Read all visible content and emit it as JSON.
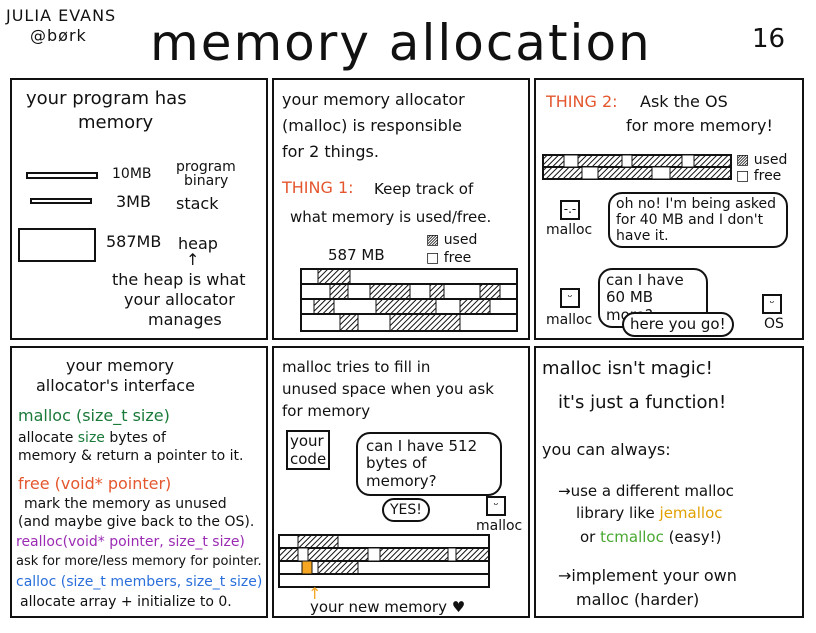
{
  "header": {
    "author_name": "JULIA EVANS",
    "author_handle": "@børk",
    "title": "memory allocation",
    "page_number": "16"
  },
  "panel1": {
    "line1": "your program has",
    "line2": "memory",
    "items": [
      {
        "size": "10MB",
        "label1": "program",
        "label2": "binary"
      },
      {
        "size": "3MB",
        "label1": "stack",
        "label2": ""
      },
      {
        "size": "587MB",
        "label1": "heap",
        "label2": ""
      }
    ],
    "caption1": "the heap is what",
    "caption2": "your allocator",
    "caption3": "manages"
  },
  "panel2": {
    "line1": "your memory allocator",
    "line2": "(malloc) is responsible",
    "line3": "for 2 things.",
    "thing_label": "THING 1:",
    "thing_text1": "Keep track of",
    "thing_text2": "what memory is used/free.",
    "heap_size": "587 MB",
    "legend_used": "used",
    "legend_free": "free"
  },
  "panel3": {
    "thing_label": "THING 2:",
    "thing_text1": "Ask the OS",
    "thing_text2": "for more memory!",
    "legend_used": "used",
    "legend_free": "free",
    "bubble1": "oh no! I'm being asked for 40 MB and I don't have it.",
    "malloc1": "malloc",
    "bubble2": "can I have 60 MB more?",
    "malloc2": "malloc",
    "bubble3": "here you go!",
    "os": "OS"
  },
  "panel4": {
    "line1": "your memory",
    "line2": "allocator's interface",
    "malloc_sig": "malloc (size_t size)",
    "malloc_desc1": "allocate",
    "malloc_desc_size": "size",
    "malloc_desc2": "bytes of",
    "malloc_desc3": "memory & return a pointer to it.",
    "free_sig": "free (void* pointer)",
    "free_desc1": "mark the memory as unused",
    "free_desc2": "(and maybe give back to the OS).",
    "realloc_sig": "realloc(void* pointer, size_t size)",
    "realloc_desc": "ask for more/less memory for pointer.",
    "calloc_sig": "calloc (size_t members, size_t size)",
    "calloc_desc": "allocate array + initialize to 0."
  },
  "panel5": {
    "line1": "malloc tries to fill in",
    "line2": "unused space when you ask",
    "line3": "for memory",
    "code_label1": "your",
    "code_label2": "code",
    "bubble1": "can I have 512 bytes of memory?",
    "bubble2": "YES!",
    "malloc": "malloc",
    "caption": "your new memory ♥"
  },
  "panel6": {
    "line1": "malloc isn't",
    "magic": "magic!",
    "line2": "it's just a function!",
    "line3": "you can always:",
    "b1a": "→use a different malloc",
    "b1b": "library like",
    "b1c": "jemalloc",
    "b1d": "or",
    "b1e": "tcmalloc",
    "b1f": "(easy!)",
    "b2a": "→implement your own",
    "b2b": "malloc (harder)"
  },
  "colors": {
    "thing": "#e4572e",
    "malloc": "#1a7a3a",
    "realloc": "#9b2bb3",
    "calloc": "#2a6fdb",
    "jemalloc": "#e2a000",
    "tcmalloc": "#4aa832"
  }
}
